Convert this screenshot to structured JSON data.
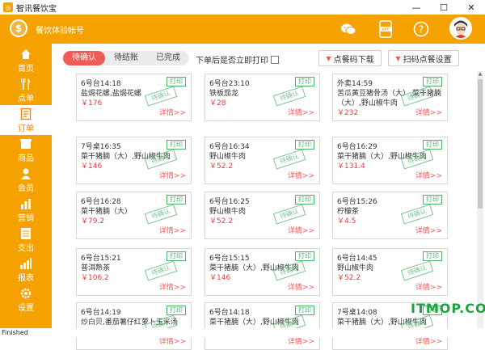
{
  "window": {
    "title": "智讯餐饮宝",
    "min": "—",
    "max": "☐",
    "close": "✕"
  },
  "header": {
    "account_name": "餐饮体验帐号",
    "app_label": "APP"
  },
  "sidebar": {
    "items": [
      {
        "label": "首页",
        "icon": "home-icon"
      },
      {
        "label": "点单",
        "icon": "cutlery-icon"
      },
      {
        "label": "订单",
        "icon": "document-icon"
      },
      {
        "label": "商品",
        "icon": "box-icon"
      },
      {
        "label": "会员",
        "icon": "member-icon"
      },
      {
        "label": "营销",
        "icon": "chart-icon"
      },
      {
        "label": "支出",
        "icon": "ledger-icon"
      },
      {
        "label": "报表",
        "icon": "report-icon"
      },
      {
        "label": "设置",
        "icon": "settings-icon"
      }
    ],
    "active_index": 2
  },
  "toolbar": {
    "tabs": [
      "待确认",
      "待结账",
      "已完成"
    ],
    "auto_print_label": "下单后是否立即打印",
    "download_btn": "点餐码下载",
    "settings_btn": "扫码点餐设置"
  },
  "orders": [
    {
      "table": "6号台14:18",
      "items": "盐焗花螺,盐焗花螺",
      "price": "￥176"
    },
    {
      "table": "6号台23:10",
      "items": "铁板茄龙",
      "price": "￥28"
    },
    {
      "table": "外卖14:59",
      "items": "苦瓜黄豆猪骨汤（大）,菜干猪腩",
      "items2": "（大）,野山椒牛肉",
      "price": "￥232"
    },
    {
      "table": "7号桌16:35",
      "items": "菜干猪腩（大）,野山椒牛肉",
      "price": "￥146"
    },
    {
      "table": "6号台16:34",
      "items": "野山椒牛肉",
      "price": "￥52.2"
    },
    {
      "table": "6号台16:29",
      "items": "菜干猪腩（大）,野山椒牛肉",
      "price": "￥131.4"
    },
    {
      "table": "6号台16:28",
      "items": "菜干猪腩（大）",
      "price": "￥79.2"
    },
    {
      "table": "6号台16:25",
      "items": "野山椒牛肉",
      "price": "￥52.2"
    },
    {
      "table": "6号台15:26",
      "items": "柠檬茶",
      "price": "￥4.5"
    },
    {
      "table": "6号台15:21",
      "items": "普洱熟茶",
      "price": "￥106.2"
    },
    {
      "table": "6号台15:15",
      "items": "菜干猪腩（大）,野山椒牛肉",
      "price": "￥146"
    },
    {
      "table": "6号台14:45",
      "items": "野山椒牛肉",
      "price": "￥52.2"
    },
    {
      "table": "6号台14:19",
      "items": "炒白贝,番茄薯仔红萝卜玉米汤",
      "price": ""
    },
    {
      "table": "6号台14:18",
      "items": "菜干猪腩（大）,野山椒牛肉",
      "price": ""
    },
    {
      "table": "7号桌14:08",
      "items": "菜干猪腩（大）,野山椒牛肉",
      "price": ""
    }
  ],
  "card_labels": {
    "print": "打印",
    "stamp": "待确认",
    "detail": "详情>>"
  },
  "statusbar": {
    "text": "Finished"
  },
  "watermark": {
    "text": "ITMOP.COM"
  }
}
